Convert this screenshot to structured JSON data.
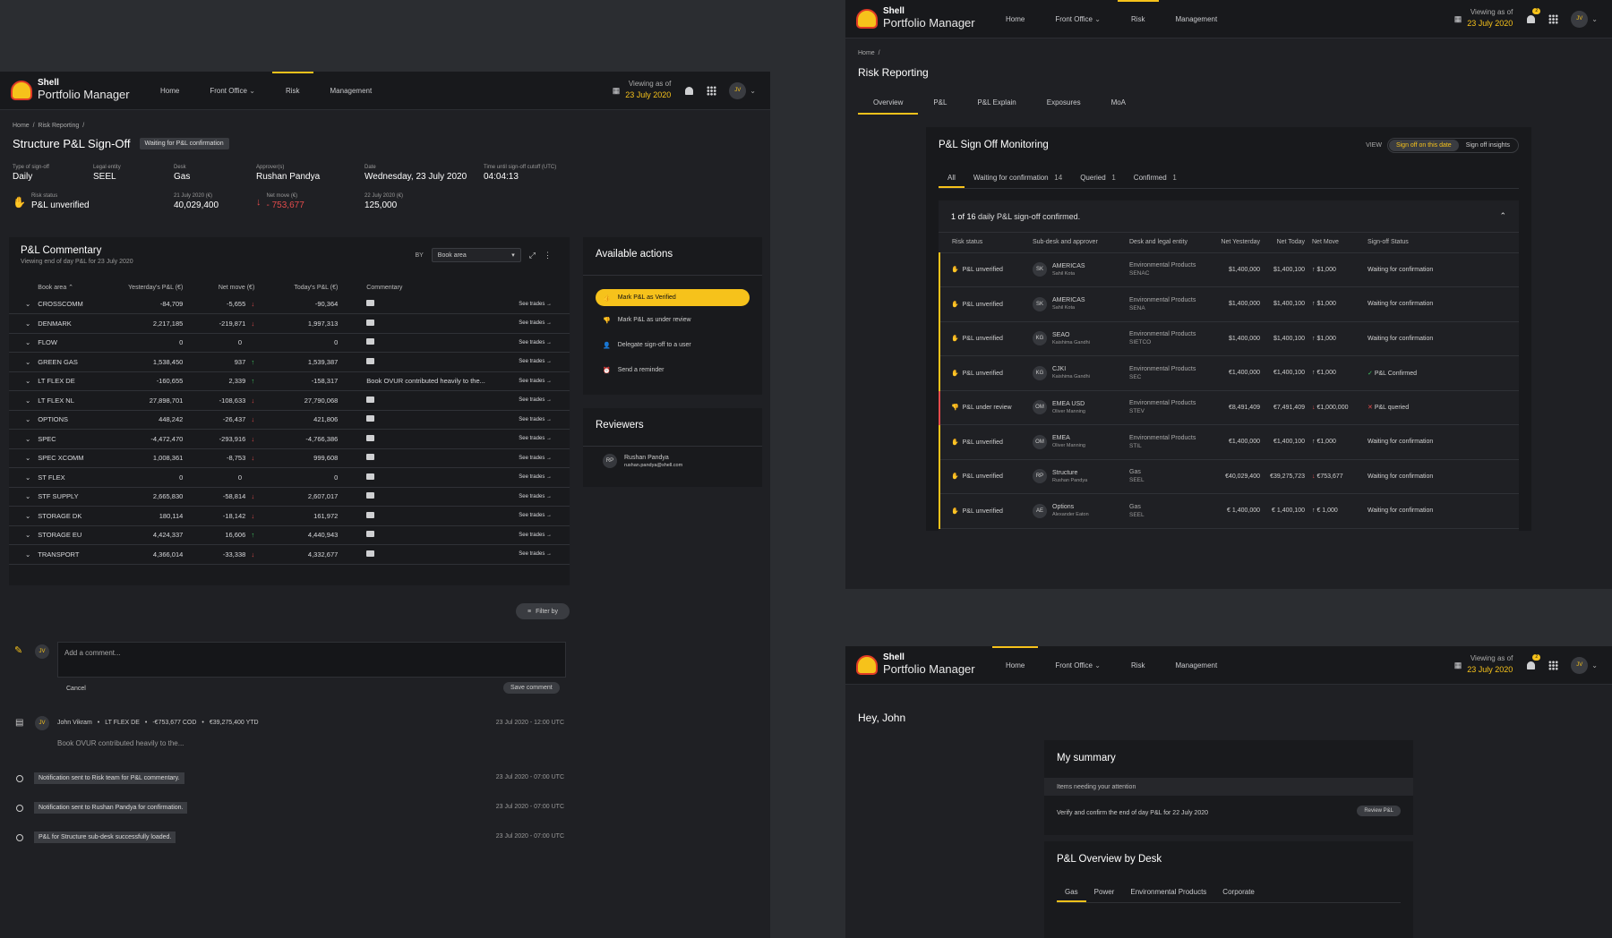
{
  "app": {
    "brand": "Shell",
    "product": "Portfolio Manager",
    "nav": [
      "Home",
      "Front Office",
      "Risk",
      "Management"
    ],
    "viewing_as_label": "Viewing as of",
    "viewing_date": "23 July 2020",
    "avatar": "JV",
    "badge": "2"
  },
  "signoff": {
    "breadcrumb": [
      "Home",
      "Risk Reporting"
    ],
    "title": "Structure P&L Sign-Off",
    "status_chip": "Waiting for P&L confirmation",
    "meta": [
      {
        "label": "Type of sign-off",
        "value": "Daily"
      },
      {
        "label": "Legal entity",
        "value": "SEEL"
      },
      {
        "label": "Desk",
        "value": "Gas"
      },
      {
        "label": "Approver(s)",
        "value": "Rushan Pandya"
      },
      {
        "label": "Date",
        "value": "Wednesday, 23 July 2020"
      },
      {
        "label": "Time until sign-off cutoff (UTC)",
        "value": "04:04:13"
      }
    ],
    "risk_status_label": "Risk status",
    "risk_status": "P&L unverified",
    "p21_label": "21 July 2020 (€)",
    "p21": "40,029,400",
    "net_label": "Net move (€)",
    "net": "- 753,677",
    "p22_label": "22 July 2020 (€)",
    "p22": "125,000",
    "commentary_title": "P&L Commentary",
    "commentary_sub": "Viewing end of day P&L for 23 July 2020",
    "by_label": "BY",
    "by_value": "Book area",
    "columns": [
      "Book area",
      "Yesterday's P&L (€)",
      "Net move (€)",
      "Today's P&L (€)",
      "Commentary"
    ],
    "see_trades": "See trades",
    "rows": [
      [
        "CROSSCOMM",
        "-84,709",
        "-5,655",
        "-90,364",
        "",
        "down"
      ],
      [
        "DENMARK",
        "2,217,185",
        "-219,871",
        "1,997,313",
        "",
        "down"
      ],
      [
        "FLOW",
        "0",
        "0",
        "0",
        "",
        ""
      ],
      [
        "GREEN GAS",
        "1,538,450",
        "937",
        "1,539,387",
        "",
        "up"
      ],
      [
        "LT FLEX DE",
        "-160,655",
        "2,339",
        "-158,317",
        "Book OVUR contributed heavily to the...",
        "up"
      ],
      [
        "LT FLEX NL",
        "27,898,701",
        "-108,633",
        "27,790,068",
        "",
        "down"
      ],
      [
        "OPTIONS",
        "448,242",
        "-26,437",
        "421,806",
        "",
        "down"
      ],
      [
        "SPEC",
        "-4,472,470",
        "-293,916",
        "-4,766,386",
        "",
        "down"
      ],
      [
        "SPEC XCOMM",
        "1,008,361",
        "-8,753",
        "999,608",
        "",
        "down"
      ],
      [
        "ST FLEX",
        "0",
        "0",
        "0",
        "",
        ""
      ],
      [
        "STF SUPPLY",
        "2,665,830",
        "-58,814",
        "2,607,017",
        "",
        "down"
      ],
      [
        "STORAGE DK",
        "180,114",
        "-18,142",
        "161,972",
        "",
        "down"
      ],
      [
        "STORAGE EU",
        "4,424,337",
        "16,606",
        "4,440,943",
        "",
        "up"
      ],
      [
        "TRANSPORT",
        "4,366,014",
        "-33,338",
        "4,332,677",
        "",
        "down"
      ]
    ],
    "actions_title": "Available actions",
    "actions": [
      "Mark P&L as Verified",
      "Mark P&L as under review",
      "Delegate sign-off to a user",
      "Send a reminder"
    ],
    "reviewers_title": "Reviewers",
    "reviewer_initials": "RP",
    "reviewer_name": "Rushan Pandya",
    "reviewer_email": "rushan.pandya@shell.com",
    "filter": "Filter by",
    "comment_placeholder": "Add a comment...",
    "cancel": "Cancel",
    "save": "Save comment",
    "comment_author": "John Vikram",
    "comment_book": "LT FLEX DE",
    "comment_cod": "-€753,677 COD",
    "comment_ytd": "€39,275,400 YTD",
    "comment_time": "23 Jul 2020 - 12:00 UTC",
    "comment_text": "Book OVUR contributed heavily to the...",
    "timeline": [
      {
        "text": "Notification sent to Risk team for P&L commentary.",
        "time": "23 Jul 2020 - 07:00 UTC"
      },
      {
        "text": "Notification sent to Rushan Pandya for confirmation.",
        "time": "23 Jul 2020 - 07:00 UTC"
      },
      {
        "text": "P&L for Structure sub-desk successfully loaded.",
        "time": "23 Jul 2020 - 07:00 UTC"
      }
    ]
  },
  "risk": {
    "breadcrumb": [
      "Home"
    ],
    "title": "Risk Reporting",
    "tabs": [
      "Overview",
      "P&L",
      "P&L Explain",
      "Exposures",
      "MoA"
    ],
    "monitor_title": "P&L Sign Off Monitoring",
    "view_label": "VIEW",
    "view_opts": [
      "Sign off on this date",
      "Sign off insights"
    ],
    "filters": [
      {
        "label": "All",
        "count": ""
      },
      {
        "label": "Waiting for confirmation",
        "count": "14"
      },
      {
        "label": "Queried",
        "count": "1"
      },
      {
        "label": "Confirmed",
        "count": "1"
      }
    ],
    "summary_a": "1 of 16",
    "summary_b": "daily P&L sign-off confirmed.",
    "columns": [
      "Risk status",
      "Sub-desk and approver",
      "Desk and legal entity",
      "Net Yesterday",
      "Net Today",
      "Net Move",
      "Sign-off Status"
    ],
    "rows": [
      {
        "status": "P&L unverified",
        "init": "SK",
        "sub": "AMERICAS",
        "who": "Sahil Kota",
        "desk": "Environmental Products",
        "ent": "SENAC",
        "y": "$1,400,000",
        "t": "$1,400,100",
        "m": "$1,000",
        "dir": "up",
        "so": "Waiting for confirmation"
      },
      {
        "status": "P&L unverified",
        "init": "SK",
        "sub": "AMERICAS",
        "who": "Sahil Kota",
        "desk": "Environmental Products",
        "ent": "SENA",
        "y": "$1,400,000",
        "t": "$1,400,100",
        "m": "$1,000",
        "dir": "up",
        "so": "Waiting for confirmation"
      },
      {
        "status": "P&L unverified",
        "init": "KG",
        "sub": "SEAO",
        "who": "Kaishima Gandhi",
        "desk": "Environmental Products",
        "ent": "SIETCO",
        "y": "$1,400,000",
        "t": "$1,400,100",
        "m": "$1,000",
        "dir": "up",
        "so": "Waiting for confirmation"
      },
      {
        "status": "P&L unverified",
        "init": "KG",
        "sub": "CJKI",
        "who": "Kaishima Gandhi",
        "desk": "Environmental Products",
        "ent": "SEC",
        "y": "€1,400,000",
        "t": "€1,400,100",
        "m": "€1,000",
        "dir": "up",
        "so": "P&L Confirmed"
      },
      {
        "status": "P&L under review",
        "init": "OM",
        "sub": "EMEA USD",
        "who": "Oliver Manning",
        "desk": "Environmental Products",
        "ent": "STEV",
        "y": "€8,491,409",
        "t": "€7,491,409",
        "m": "€1,000,000",
        "dir": "down",
        "so": "P&L queried"
      },
      {
        "status": "P&L unverified",
        "init": "OM",
        "sub": "EMEA",
        "who": "Oliver Manning",
        "desk": "Environmental Products",
        "ent": "STIL",
        "y": "€1,400,000",
        "t": "€1,400,100",
        "m": "€1,000",
        "dir": "up",
        "so": "Waiting for confirmation"
      },
      {
        "status": "P&L unverified",
        "init": "RP",
        "sub": "Structure",
        "who": "Rushan Pandya",
        "desk": "Gas",
        "ent": "SEEL",
        "y": "€40,029,400",
        "t": "€39,275,723",
        "m": "€753,677",
        "dir": "down",
        "so": "Waiting for confirmation"
      },
      {
        "status": "P&L unverified",
        "init": "AE",
        "sub": "Options",
        "who": "Alexander Eaton",
        "desk": "Gas",
        "ent": "SEEL",
        "y": "€ 1,400,000",
        "t": "€ 1,400,100",
        "m": "€ 1,000",
        "dir": "up",
        "so": "Waiting for confirmation"
      }
    ]
  },
  "home": {
    "greeting": "Hey, John",
    "summary_title": "My summary",
    "attention": "Items needing your attention",
    "task": "Verify and confirm the end of day P&L for 22 July 2020",
    "review_btn": "Review P&L",
    "overview_title": "P&L Overview by Desk",
    "desk_tabs": [
      "Gas",
      "Power",
      "Environmental Products",
      "Corporate"
    ]
  }
}
